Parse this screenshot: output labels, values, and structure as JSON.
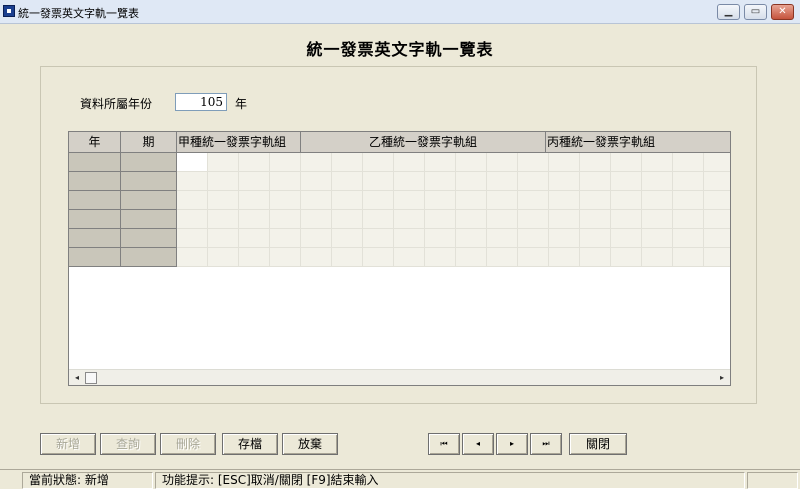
{
  "window": {
    "title": "統一發票英文字軌一覽表",
    "minimize_glyph": "▁",
    "restore_glyph": "▭",
    "close_glyph": "✕"
  },
  "page_title": "統一發票英文字軌一覽表",
  "form": {
    "year_label": "資料所屬年份",
    "year_value": "105",
    "year_unit": "年"
  },
  "grid": {
    "headers": {
      "year": "年",
      "period": "期",
      "group_a": "甲種統一發票字軌組",
      "group_b": "乙種統一發票字軌組",
      "group_c": "丙種統一發票字軌組"
    },
    "scroll_left_glyph": "◂",
    "scroll_right_glyph": "▸"
  },
  "buttons": {
    "add": "新增",
    "query": "查詢",
    "delete": "刪除",
    "save": "存檔",
    "discard": "放棄",
    "first": "⏮",
    "prev": "◂",
    "next": "▸",
    "last": "⏭",
    "close": "關閉"
  },
  "status": {
    "state": "當前狀態: 新增",
    "hint": "功能提示: [ESC]取消/關閉 [F9]結束輸入"
  }
}
